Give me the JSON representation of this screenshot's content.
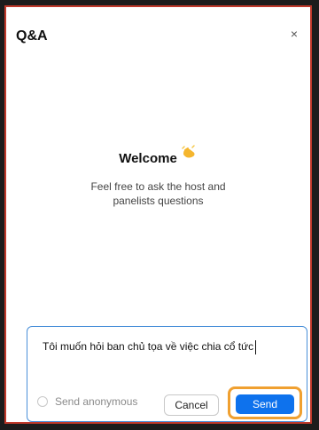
{
  "dialog": {
    "title": "Q&A",
    "close_label": "×"
  },
  "welcome": {
    "title": "Welcome",
    "subtitle_line1": "Feel free to ask the host and",
    "subtitle_line2": "panelists questions"
  },
  "compose": {
    "text": "Tôi muốn hỏi ban chủ tọa về việc chia cổ tức",
    "anonymous_label": "Send anonymous",
    "anonymous_checked": false,
    "cancel_label": "Cancel",
    "send_label": "Send"
  },
  "colors": {
    "border_accent": "#c0392b",
    "input_border": "#4a90d9",
    "send_bg": "#0e72ed",
    "highlight": "#f0a030"
  },
  "icons": {
    "welcome_icon": "waving-hand-icon",
    "close_icon": "close-icon"
  }
}
